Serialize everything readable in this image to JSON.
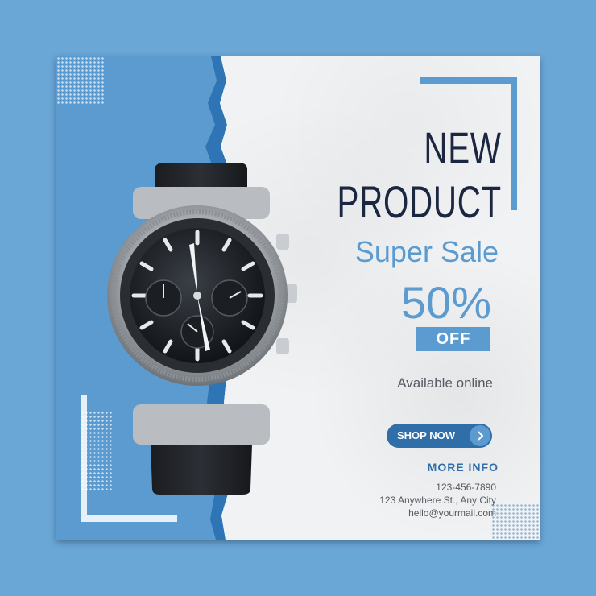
{
  "headline": {
    "line1": "NEW",
    "line2": "PRODUCT"
  },
  "subheadline": "Super Sale",
  "discount": {
    "value": "50%",
    "label": "OFF"
  },
  "availability": "Available online",
  "cta": {
    "label": "SHOP NOW",
    "icon": "chevron-right-icon"
  },
  "more_info": "MORE INFO",
  "contact": {
    "phone": "123-456-7890",
    "address": "123 Anywhere St., Any City",
    "email": "hello@yourmail.com"
  },
  "colors": {
    "background": "#6aa6d6",
    "accent": "#5b9bd0",
    "dark_accent": "#2f6ea8",
    "headline": "#1b2640",
    "paper": "#f1f2f3"
  }
}
